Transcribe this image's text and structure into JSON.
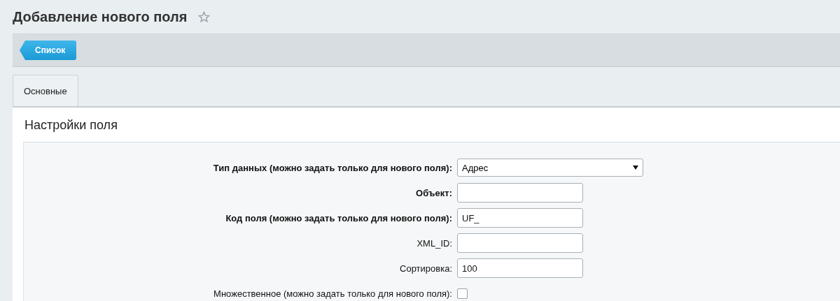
{
  "page": {
    "title": "Добавление нового поля",
    "favorite": false
  },
  "toolbar": {
    "back_button": "Список"
  },
  "tabs": [
    {
      "label": "Основные",
      "selected": true
    }
  ],
  "section": {
    "title": "Настройки поля"
  },
  "fields": [
    {
      "kind": "select",
      "label": "Тип данных (можно задать только для нового поля):",
      "required": true,
      "value": "Адрес"
    },
    {
      "kind": "text",
      "label": "Объект:",
      "required": true
    },
    {
      "kind": "text",
      "label": "Код поля (можно задать только для нового поля):",
      "required": true,
      "value": "UF_"
    },
    {
      "kind": "text",
      "label": "XML_ID:",
      "required": false
    },
    {
      "kind": "text",
      "label": "Сортировка:",
      "required": false,
      "value": "100"
    },
    {
      "kind": "checkbox",
      "label": "Множественное (можно задать только для нового поля):",
      "required": false,
      "checked": false
    }
  ]
}
